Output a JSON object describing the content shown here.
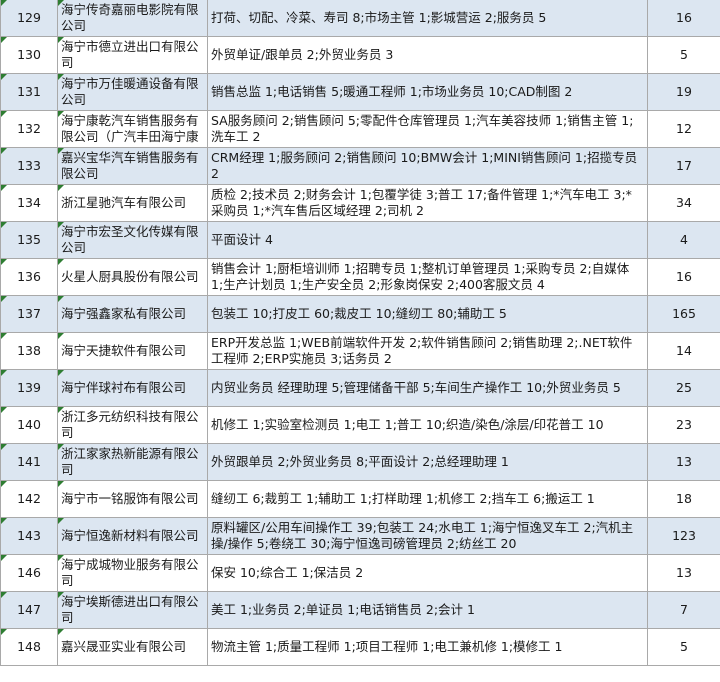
{
  "rows": [
    {
      "num": "129",
      "company": "海宁传奇嘉丽电影院有限公司",
      "positions": "打荷、切配、冷菜、寿司 8;市场主管 1;影城营运 2;服务员 5",
      "count": "16"
    },
    {
      "num": "130",
      "company": "海宁市德立进出口有限公司",
      "positions": "外贸单证/跟单员 2;外贸业务员 3",
      "count": "5"
    },
    {
      "num": "131",
      "company": "海宁市万佳暖通设备有限公司",
      "positions": "销售总监 1;电话销售 5;暖通工程师 1;市场业务员 10;CAD制图 2",
      "count": "19"
    },
    {
      "num": "132",
      "company": "海宁康乾汽车销售服务有限公司（广汽丰田海宁康乾文苑路店）",
      "positions": "SA服务顾问 2;销售顾问 5;零配件仓库管理员 1;汽车美容技师 1;销售主管 1;洗车工 2",
      "count": "12"
    },
    {
      "num": "133",
      "company": "嘉兴宝华汽车销售服务有限公司",
      "positions": "CRM经理 1;服务顾问 2;销售顾问 10;BMW会计 1;MINI销售顾问 1;招揽专员 2",
      "count": "17"
    },
    {
      "num": "134",
      "company": "浙江星驰汽车有限公司",
      "positions": "质检 2;技术员 2;财务会计 1;包覆学徒 3;普工 17;备件管理 1;*汽车电工 3;*采购员 1;*汽车售后区域经理 2;司机 2",
      "count": "34"
    },
    {
      "num": "135",
      "company": "海宁市宏圣文化传媒有限公司",
      "positions": "平面设计 4",
      "count": "4"
    },
    {
      "num": "136",
      "company": "火星人厨具股份有限公司",
      "positions": "销售会计 1;厨柜培训师 1;招聘专员 1;整机订单管理员 1;采购专员 2;自媒体 1;生产计划员 1;生产安全员 2;形象岗保安 2;400客服文员 4",
      "count": "16"
    },
    {
      "num": "137",
      "company": "海宁强鑫家私有限公司",
      "positions": "包装工 10;打皮工 60;裁皮工 10;缝纫工 80;辅助工 5",
      "count": "165"
    },
    {
      "num": "138",
      "company": "海宁天捷软件有限公司",
      "positions": "ERP开发总监 1;WEB前端软件开发 2;软件销售顾问  2;销售助理 2;.NET软件工程师 2;ERP实施员 3;话务员 2",
      "count": "14"
    },
    {
      "num": "139",
      "company": "海宁伴球衬布有限公司",
      "positions": "内贸业务员 经理助理 5;管理储备干部 5;车间生产操作工 10;外贸业务员 5",
      "count": "25"
    },
    {
      "num": "140",
      "company": "浙江多元纺织科技有限公司",
      "positions": "机修工 1;实验室检测员 1;电工 1;普工 10;织造/染色/涂层/印花普工 10",
      "count": "23"
    },
    {
      "num": "141",
      "company": "浙江家家热新能源有限公司",
      "positions": "外贸跟单员 2;外贸业务员 8;平面设计 2;总经理助理 1",
      "count": "13"
    },
    {
      "num": "142",
      "company": "海宁市一铭服饰有限公司",
      "positions": "缝纫工 6;裁剪工 1;辅助工 1;打样助理 1;机修工 2;挡车工 6;搬运工 1",
      "count": "18"
    },
    {
      "num": "143",
      "company": "海宁恒逸新材料有限公司",
      "positions": "原料罐区/公用车间操作工 39;包装工 24;水电工 1;海宁恒逸叉车工 2;汽机主操/操作 5;卷绕工 30;海宁恒逸司磅管理员 2;纺丝工 20",
      "count": "123"
    },
    {
      "num": "146",
      "company": "海宁成城物业服务有限公司",
      "positions": "保安 10;综合工 1;保洁员 2",
      "count": "13"
    },
    {
      "num": "147",
      "company": "海宁埃斯德进出口有限公司",
      "positions": "美工 1;业务员 2;单证员 1;电话销售员 2;会计 1",
      "count": "7"
    },
    {
      "num": "148",
      "company": "嘉兴晟亚实业有限公司",
      "positions": "物流主管 1;质量工程师 1;项目工程师 1;电工兼机修 1;模修工 1",
      "count": "5"
    }
  ],
  "colors": {
    "odd_row": "#dce6f1",
    "even_row": "#ffffff",
    "grid": "#a9a9a9",
    "flag": "#2e7d32"
  }
}
